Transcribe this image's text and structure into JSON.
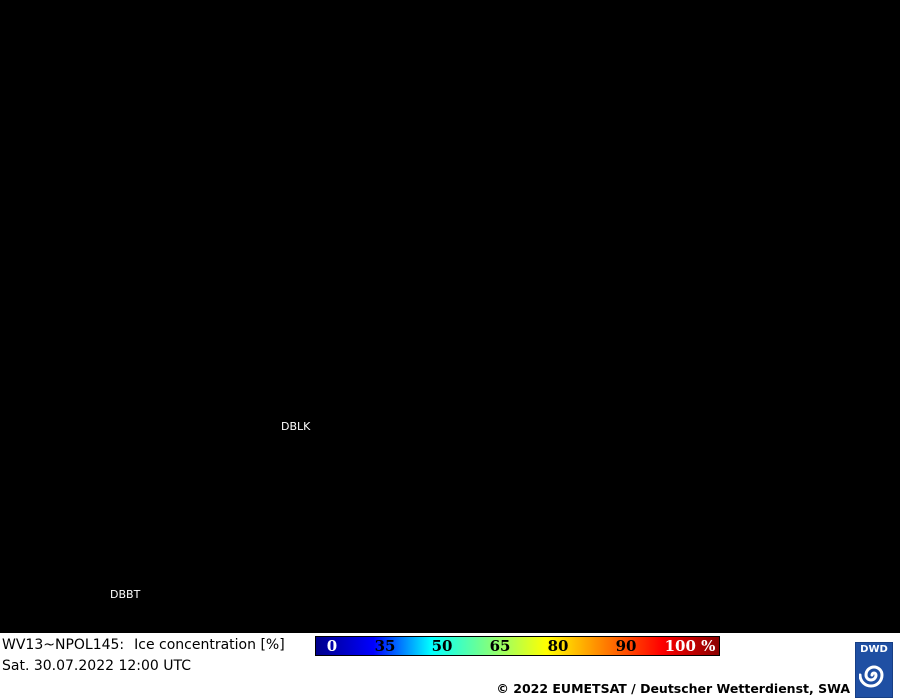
{
  "map": {
    "stations": [
      {
        "id": "DBLK"
      },
      {
        "id": "DBBT"
      }
    ]
  },
  "product": {
    "id": "WV13~NPOL145:",
    "parameter": "Ice concentration [%]",
    "datetime": "Sat. 30.07.2022 12:00 UTC"
  },
  "colorbar": {
    "labels": [
      "0",
      "35",
      "50",
      "65",
      "80",
      "90",
      "100 %"
    ],
    "label_colors": [
      "#ffffff",
      "#000000",
      "#000000",
      "#000000",
      "#000000",
      "#000000",
      "#ffffff"
    ],
    "gradient_colors": [
      "#00008b",
      "#0000ff",
      "#00ffff",
      "#80ff80",
      "#ffff00",
      "#ff8000",
      "#ff0000",
      "#8b0000"
    ]
  },
  "footer": {
    "copyright": "© 2022 EUMETSAT / Deutscher Wetterdienst, SWA"
  },
  "logo": {
    "text": "DWD",
    "color": "#1f4fa3"
  }
}
